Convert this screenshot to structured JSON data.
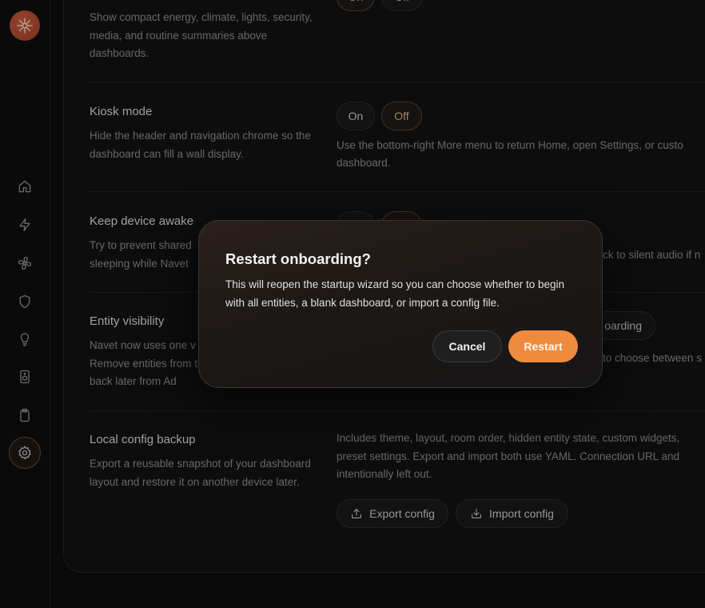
{
  "sidebar": {
    "logo_icon": "sunburst-logo",
    "items": [
      {
        "icon": "home-icon"
      },
      {
        "icon": "lightning-icon"
      },
      {
        "icon": "fan-icon"
      },
      {
        "icon": "shield-icon"
      },
      {
        "icon": "lightbulb-icon"
      },
      {
        "icon": "speaker-icon"
      },
      {
        "icon": "clipboard-icon"
      },
      {
        "icon": "gear-icon",
        "active": true
      }
    ]
  },
  "settings": {
    "summaries": {
      "desc": "Show compact energy, climate, lights, security, media, and routine summaries above dashboards.",
      "on_label": "On",
      "off_label": "Off"
    },
    "kiosk": {
      "title": "Kiosk mode",
      "desc": "Hide the header and navigation chrome so the dashboard can fill a wall display.",
      "on_label": "On",
      "off_label": "Off",
      "selected": "Off",
      "note_line1": "Use the bottom-right More menu to return Home, open Settings, or custo",
      "note_line2": "dashboard."
    },
    "awake": {
      "title": "Keep device awake",
      "desc": "Try to prevent shared sleeping while Navet",
      "note": "ck to silent audio if n"
    },
    "visibility": {
      "title": "Entity visibility",
      "desc": "Navet now uses one v Remove entities from them back later from Ad",
      "button_label": "oarding",
      "note": "to choose between s"
    },
    "backup": {
      "title": "Local config backup",
      "desc": "Export a reusable snapshot of your dashboard layout and restore it on another device later.",
      "note_line1": "Includes theme, layout, room order, hidden entity state, custom widgets,",
      "note_line2": "preset settings. Export and import both use YAML. Connection URL and",
      "note_line3": "intentionally left out.",
      "export_label": "Export config",
      "import_label": "Import config"
    }
  },
  "modal": {
    "title": "Restart onboarding?",
    "body": "This will reopen the startup wizard so you can choose whether to begin with all entities, a blank dashboard, or import a config file.",
    "cancel_label": "Cancel",
    "restart_label": "Restart",
    "accent": "#f08a3c"
  }
}
